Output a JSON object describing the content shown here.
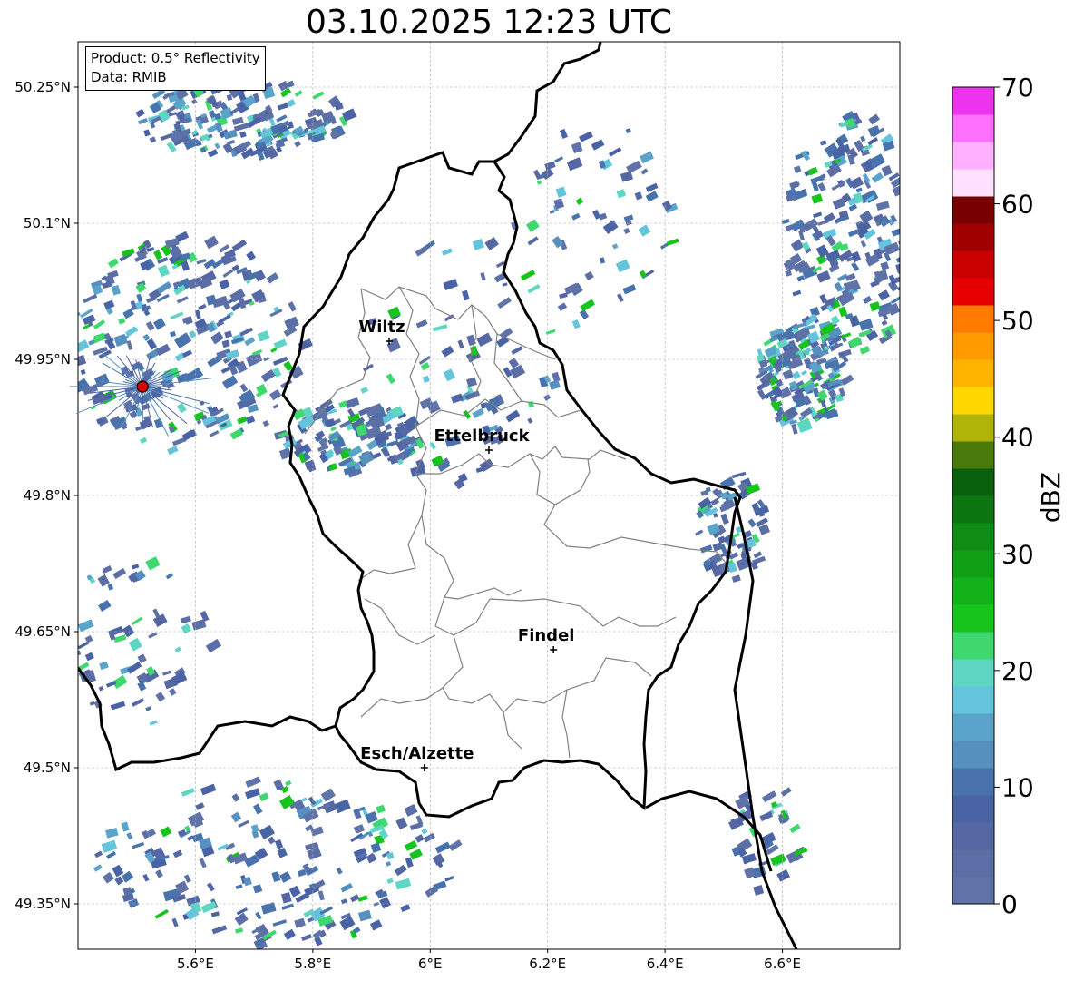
{
  "title": "03.10.2025 12:23 UTC",
  "info": {
    "product": "Product: 0.5° Reflectivity",
    "data": "Data: RMIB"
  },
  "lat_labels": [
    "50.25°N",
    "50.1°N",
    "49.95°N",
    "49.8°N",
    "49.65°N",
    "49.5°N",
    "49.35°N"
  ],
  "lat_values": [
    50.25,
    50.1,
    49.95,
    49.8,
    49.65,
    49.5,
    49.35
  ],
  "lon_labels": [
    "5.6°E",
    "5.8°E",
    "6°E",
    "6.2°E",
    "6.4°E",
    "6.6°E"
  ],
  "lon_values": [
    5.6,
    5.8,
    6.0,
    6.2,
    6.4,
    6.6
  ],
  "cities": [
    {
      "name": "Wiltz",
      "lon": 5.93,
      "lat": 49.97
    },
    {
      "name": "Ettelbruck",
      "lon": 6.1,
      "lat": 49.85
    },
    {
      "name": "Findel",
      "lon": 6.21,
      "lat": 49.63
    },
    {
      "name": "Esch/Alzette",
      "lon": 5.99,
      "lat": 49.5
    }
  ],
  "radar_site": {
    "lon": 5.51,
    "lat": 49.92
  },
  "colorbar": {
    "label": "dBZ",
    "ticks": [
      0,
      10,
      20,
      30,
      40,
      50,
      60,
      70
    ],
    "colors": [
      "#6073a8",
      "#5b6fa6",
      "#5568a3",
      "#4a63a5",
      "#4873ad",
      "#5590bf",
      "#5aa3cb",
      "#64c4dc",
      "#5fd6c4",
      "#3fd86e",
      "#16c41c",
      "#14b11a",
      "#119f15",
      "#0f8c13",
      "#0c7710",
      "#09600c",
      "#4a7a0c",
      "#b0b409",
      "#ffd700",
      "#ffb400",
      "#ff9a00",
      "#ff7a00",
      "#e60000",
      "#c80000",
      "#a00000",
      "#780000",
      "#ffe0ff",
      "#ffb0ff",
      "#ff70ff",
      "#ee33ee"
    ]
  },
  "chart_data": {
    "type": "heatmap",
    "title": "03.10.2025 12:23 UTC",
    "xlabel": "",
    "ylabel": "",
    "xlim": [
      5.4,
      6.8
    ],
    "ylim": [
      49.3,
      50.3
    ],
    "colorbar_label": "dBZ",
    "colorbar_range": [
      0,
      70
    ]
  }
}
